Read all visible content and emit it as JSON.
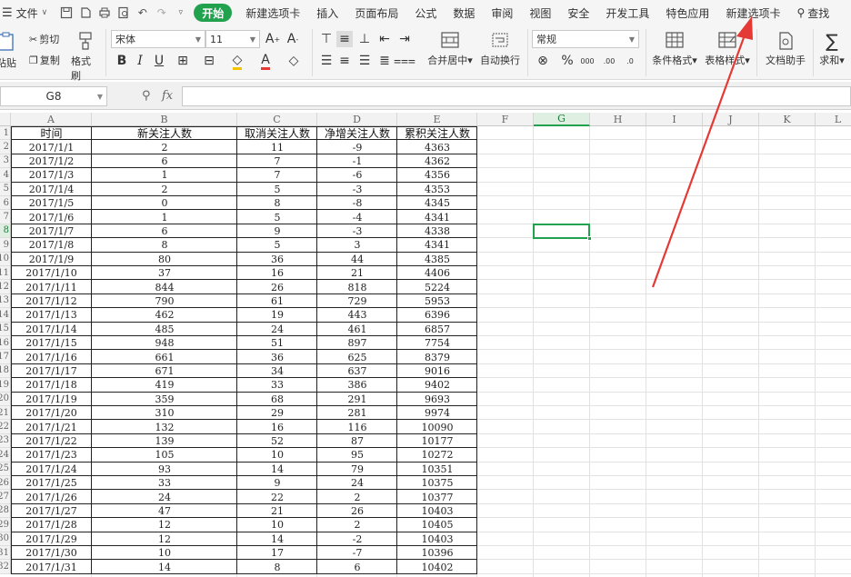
{
  "menubar": {
    "file_label": "文件",
    "tabs": [
      {
        "label": "开始",
        "active": true
      },
      {
        "label": "新建选项卡",
        "active": false
      },
      {
        "label": "插入",
        "active": false
      },
      {
        "label": "页面布局",
        "active": false
      },
      {
        "label": "公式",
        "active": false
      },
      {
        "label": "数据",
        "active": false
      },
      {
        "label": "审阅",
        "active": false
      },
      {
        "label": "视图",
        "active": false
      },
      {
        "label": "安全",
        "active": false
      },
      {
        "label": "开发工具",
        "active": false
      },
      {
        "label": "特色应用",
        "active": false
      },
      {
        "label": "新建选项卡",
        "active": false
      }
    ],
    "search_label": "查找"
  },
  "ribbon": {
    "paste_label": "粘贴",
    "cut_label": "剪切",
    "copy_label": "复制",
    "format_painter_label": "格式刷",
    "font_name": "宋体",
    "font_size": "11",
    "merge_center_label": "合并居中",
    "wrap_label": "自动换行",
    "number_format": "常规",
    "conditional_format_label": "条件格式",
    "table_style_label": "表格样式",
    "doc_helper_label": "文档助手",
    "sum_label": "求和"
  },
  "formula_bar": {
    "cell_ref": "G8",
    "fx_label": "fx",
    "value": ""
  },
  "sheet": {
    "columns": [
      "A",
      "B",
      "C",
      "D",
      "E",
      "F",
      "G",
      "H",
      "I",
      "J",
      "K",
      "L"
    ],
    "row_numbers": [
      "1",
      "2",
      "3",
      "4",
      "5",
      "6",
      "7",
      "8",
      "9",
      "10",
      "11",
      "12",
      "13",
      "14",
      "15",
      "16",
      "17",
      "18",
      "19",
      "20",
      "21",
      "22",
      "23",
      "24",
      "25",
      "26",
      "27",
      "28",
      "29",
      "30",
      "31",
      "32"
    ],
    "selected_cell": "G8",
    "headers": [
      "时间",
      "新关注人数",
      "取消关注人数",
      "净增关注人数",
      "累积关注人数"
    ],
    "rows": [
      [
        "2017/1/1",
        "2",
        "11",
        "-9",
        "4363"
      ],
      [
        "2017/1/2",
        "6",
        "7",
        "-1",
        "4362"
      ],
      [
        "2017/1/3",
        "1",
        "7",
        "-6",
        "4356"
      ],
      [
        "2017/1/4",
        "2",
        "5",
        "-3",
        "4353"
      ],
      [
        "2017/1/5",
        "0",
        "8",
        "-8",
        "4345"
      ],
      [
        "2017/1/6",
        "1",
        "5",
        "-4",
        "4341"
      ],
      [
        "2017/1/7",
        "6",
        "9",
        "-3",
        "4338"
      ],
      [
        "2017/1/8",
        "8",
        "5",
        "3",
        "4341"
      ],
      [
        "2017/1/9",
        "80",
        "36",
        "44",
        "4385"
      ],
      [
        "2017/1/10",
        "37",
        "16",
        "21",
        "4406"
      ],
      [
        "2017/1/11",
        "844",
        "26",
        "818",
        "5224"
      ],
      [
        "2017/1/12",
        "790",
        "61",
        "729",
        "5953"
      ],
      [
        "2017/1/13",
        "462",
        "19",
        "443",
        "6396"
      ],
      [
        "2017/1/14",
        "485",
        "24",
        "461",
        "6857"
      ],
      [
        "2017/1/15",
        "948",
        "51",
        "897",
        "7754"
      ],
      [
        "2017/1/16",
        "661",
        "36",
        "625",
        "8379"
      ],
      [
        "2017/1/17",
        "671",
        "34",
        "637",
        "9016"
      ],
      [
        "2017/1/18",
        "419",
        "33",
        "386",
        "9402"
      ],
      [
        "2017/1/19",
        "359",
        "68",
        "291",
        "9693"
      ],
      [
        "2017/1/20",
        "310",
        "29",
        "281",
        "9974"
      ],
      [
        "2017/1/21",
        "132",
        "16",
        "116",
        "10090"
      ],
      [
        "2017/1/22",
        "139",
        "52",
        "87",
        "10177"
      ],
      [
        "2017/1/23",
        "105",
        "10",
        "95",
        "10272"
      ],
      [
        "2017/1/24",
        "93",
        "14",
        "79",
        "10351"
      ],
      [
        "2017/1/25",
        "33",
        "9",
        "24",
        "10375"
      ],
      [
        "2017/1/26",
        "24",
        "22",
        "2",
        "10377"
      ],
      [
        "2017/1/27",
        "47",
        "21",
        "26",
        "10403"
      ],
      [
        "2017/1/28",
        "12",
        "10",
        "2",
        "10405"
      ],
      [
        "2017/1/29",
        "12",
        "14",
        "-2",
        "10403"
      ],
      [
        "2017/1/30",
        "10",
        "17",
        "-7",
        "10396"
      ],
      [
        "2017/1/31",
        "14",
        "8",
        "6",
        "10402"
      ]
    ]
  },
  "colors": {
    "accent": "#22a24f",
    "annotation_arrow": "#e53935"
  }
}
